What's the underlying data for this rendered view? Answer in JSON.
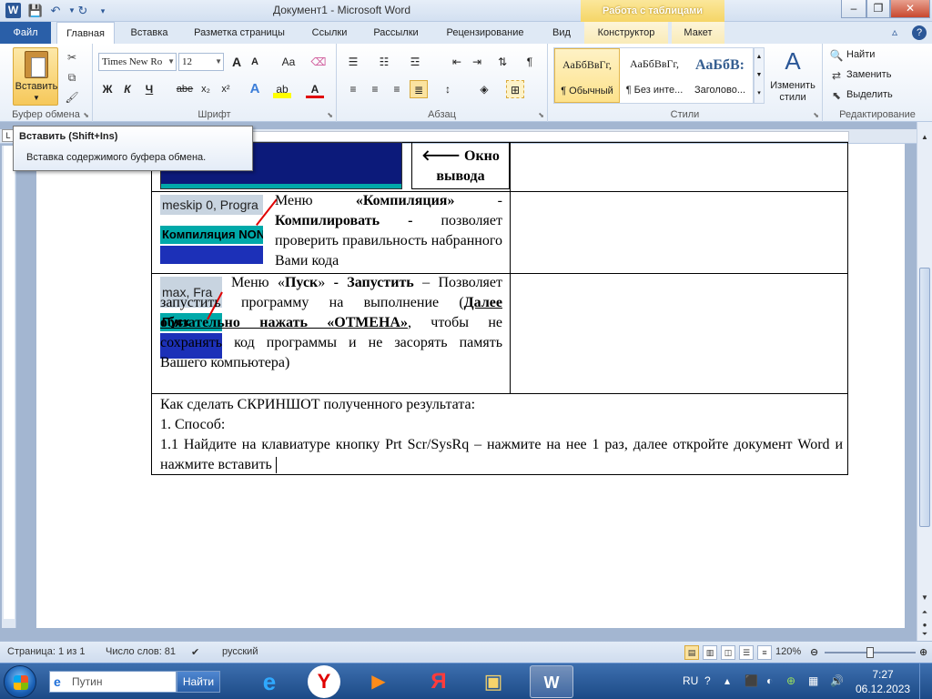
{
  "window": {
    "title": "Документ1  -  Microsoft Word",
    "context_group": "Работа с таблицами",
    "logo": "W"
  },
  "tabs": {
    "file": "Файл",
    "items": [
      "Главная",
      "Вставка",
      "Разметка страницы",
      "Ссылки",
      "Рассылки",
      "Рецензирование",
      "Вид",
      "Конструктор",
      "Макет"
    ]
  },
  "ribbon": {
    "clipboard": {
      "label": "Буфер обмена",
      "paste": "Вставить"
    },
    "font": {
      "label": "Шрифт",
      "font_name": "Times New Ro",
      "font_size": "12",
      "bold": "Ж",
      "italic": "К",
      "underline": "Ч",
      "strike": "abe",
      "subscript": "x₂",
      "superscript": "x²",
      "grow": "A",
      "shrink": "A",
      "case": "Aa"
    },
    "paragraph": {
      "label": "Абзац"
    },
    "styles": {
      "label": "Стили",
      "items": [
        {
          "sample": "АаБбВвГг,",
          "name": "¶ Обычный"
        },
        {
          "sample": "АаБбВвГг,",
          "name": "¶ Без инте..."
        },
        {
          "sample": "АаБбВ:",
          "name": "Заголово..."
        }
      ],
      "change": "Изменить стили"
    },
    "editing": {
      "label": "Редактирование",
      "find": "Найти",
      "replace": "Заменить",
      "select": "Выделить"
    }
  },
  "tooltip": {
    "title": "Вставить (Shift+Ins)",
    "body": "Вставка содержимого буфера обмена."
  },
  "document": {
    "row1_label_line1": "Окно",
    "row1_label_line2": "вывода",
    "row2_image_top": "meskip  0, Progra",
    "row2_image_menu": "Компиляция  NONAM",
    "row2_text": [
      {
        "t": "Меню ",
        "b": false
      },
      {
        "t": "«Компиляция»",
        "b": true
      },
      {
        "t": " - ",
        "b": false
      },
      {
        "t": "Компилировать - ",
        "b": true
      },
      {
        "t": "позволяет проверить правильность набранного Вами кода",
        "b": false
      }
    ],
    "row3_image_top": "max, Fra",
    "row3_image_menu": "Пуск",
    "row3_text": [
      {
        "t": "Меню «",
        "b": false
      },
      {
        "t": "Пуск",
        "b": true
      },
      {
        "t": "» ",
        "b": false
      },
      {
        "t": "- Запустить",
        "b": true
      },
      {
        "t": " – Позволяет запустить программу на выполнение (",
        "b": false
      },
      {
        "t": "Далее обязательно нажать «ОТМЕНА»",
        "b": true,
        "u": true
      },
      {
        "t": ", чтобы не сохранять код программы  и не засорять память Вашего компьютера)",
        "b": false
      }
    ],
    "row4_line1": "Как сделать СКРИНШОТ полученного результата:",
    "row4_line2": "1. Способ:",
    "row4_line3": "1.1 Найдите на клавиатуре кнопку Prt Scr/SysRq – нажмите на нее 1 раз, далее откройте документ Word  и нажмите вставить"
  },
  "statusbar": {
    "page": "Страница: 1 из 1",
    "words": "Число слов: 81",
    "language": "русский",
    "zoom": "120%"
  },
  "taskbar": {
    "search_placeholder": "Путин",
    "search_button": "Найти",
    "lang": "RU",
    "time": "7:27",
    "date": "06.12.2023"
  }
}
